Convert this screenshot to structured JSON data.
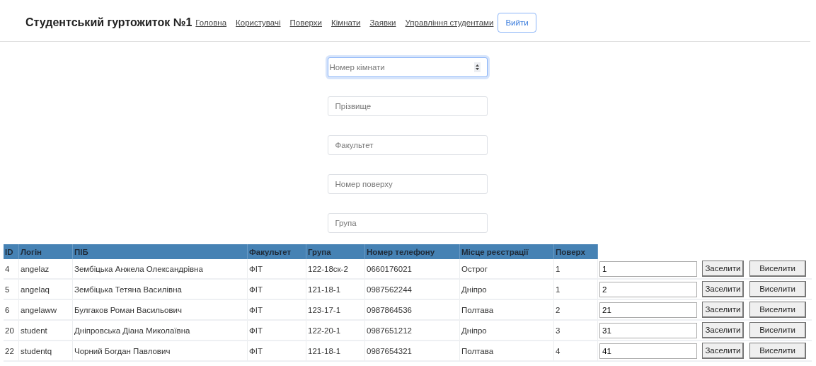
{
  "nav": {
    "brand": "Студентський гуртожиток №1",
    "links": [
      "Головна",
      "Користувачі",
      "Поверхи",
      "Кімнати",
      "Заявки",
      "Управління студентами"
    ],
    "logout": "Вийти"
  },
  "filters": [
    {
      "kind": "number",
      "placeholder": "Номер кімнати",
      "focused": true
    },
    {
      "kind": "text",
      "placeholder": "Прізвище",
      "focused": false
    },
    {
      "kind": "text",
      "placeholder": "Факультет",
      "focused": false
    },
    {
      "kind": "text",
      "placeholder": "Номер поверху",
      "focused": false
    },
    {
      "kind": "text",
      "placeholder": "Група",
      "focused": false
    }
  ],
  "table": {
    "columns": [
      "ID",
      "Логін",
      "ПІБ",
      "Факультет",
      "Група",
      "Номер телефону",
      "Місце реєстрації",
      "Поверх"
    ],
    "rows": [
      {
        "cells": [
          "4",
          "angelaz",
          "Зембіцька Анжела Олександрівна",
          "ФІТ",
          "122-18ск-2",
          "0660176021",
          "Острог",
          "1"
        ],
        "room": "1",
        "settle": "Заселити",
        "evict": "Виселити"
      },
      {
        "cells": [
          "5",
          "angelaq",
          "Зембіцька Тетяна Василівна",
          "ФІТ",
          "121-18-1",
          "0987562244",
          "Дніпро",
          "1"
        ],
        "room": "2",
        "settle": "Заселити",
        "evict": "Виселити"
      },
      {
        "cells": [
          "6",
          "angelaww",
          "Булгаков Роман Васильович",
          "ФІТ",
          "123-17-1",
          "0987864536",
          "Полтава",
          "2"
        ],
        "room": "21",
        "settle": "Заселити",
        "evict": "Виселити"
      },
      {
        "cells": [
          "20",
          "student",
          "Дніпровська Діана Миколаївна",
          "ФІТ",
          "122-20-1",
          "0987651212",
          "Дніпро",
          "3"
        ],
        "room": "31",
        "settle": "Заселити",
        "evict": "Виселити"
      },
      {
        "cells": [
          "22",
          "studentq",
          "Чорний Богдан Павлович",
          "ФІТ",
          "121-18-1",
          "0987654321",
          "Полтава",
          "4"
        ],
        "room": "41",
        "settle": "Заселити",
        "evict": "Виселити"
      }
    ]
  }
}
